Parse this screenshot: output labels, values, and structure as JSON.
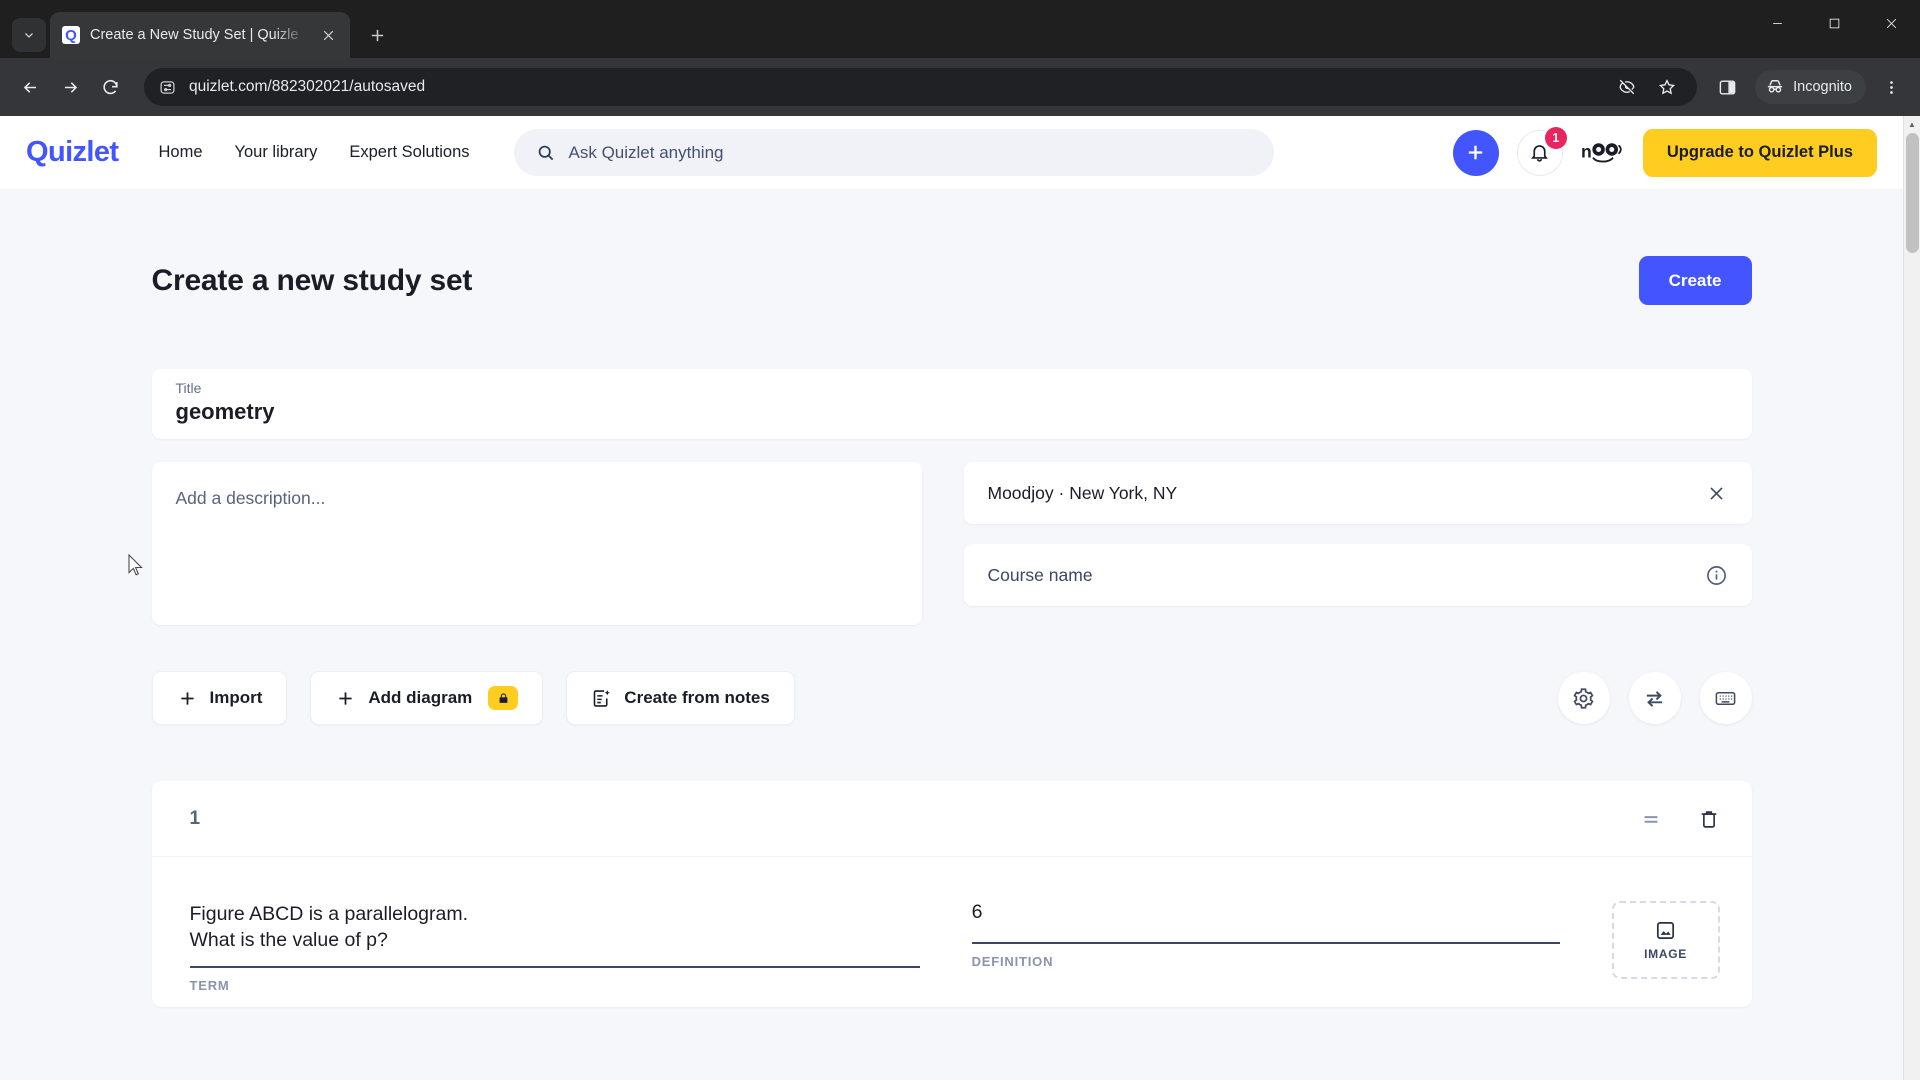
{
  "browser": {
    "tab": {
      "title": "Create a New Study Set | Quizle",
      "favicon_letter": "Q"
    },
    "tab_list_icon": "chevron-down-icon",
    "new_tab_icon": "plus-icon",
    "window_controls": [
      "minimize",
      "maximize",
      "close"
    ],
    "nav": {
      "back": "back-arrow-icon",
      "forward": "forward-arrow-icon",
      "reload": "reload-icon"
    },
    "omnibox": {
      "site_info_icon": "page-settings-icon",
      "url": "quizlet.com/882302021/autosaved",
      "actions": [
        "eye-off-icon",
        "star-icon",
        "side-panel-icon"
      ]
    },
    "incognito": {
      "label": "Incognito",
      "icon": "incognito-icon"
    },
    "menu_icon": "kebab-menu-icon"
  },
  "header": {
    "logo": "Quizlet",
    "nav": [
      {
        "label": "Home"
      },
      {
        "label": "Your library"
      },
      {
        "label": "Expert Solutions"
      }
    ],
    "search": {
      "placeholder": "Ask Quizlet anything",
      "icon": "search-icon"
    },
    "create_icon": "plus-icon",
    "notifications": {
      "icon": "bell-icon",
      "count": "1"
    },
    "avatar": "user-avatar",
    "upgrade": {
      "label": "Upgrade to Quizlet Plus"
    }
  },
  "page": {
    "title": "Create a new study set",
    "create_button": "Create"
  },
  "form": {
    "title_field": {
      "label": "Title",
      "value": "geometry"
    },
    "description": {
      "placeholder": "Add a description..."
    },
    "school": {
      "value": "Moodjoy · New York, NY",
      "clear_icon": "close-icon"
    },
    "course": {
      "placeholder": "Course name",
      "info_icon": "info-icon"
    }
  },
  "toolbar": {
    "import": {
      "label": "Import",
      "icon": "plus-icon"
    },
    "add_diagram": {
      "label": "Add diagram",
      "icon": "plus-icon",
      "badge_icon": "lock-icon"
    },
    "create_from_notes": {
      "label": "Create from notes",
      "icon": "notes-sparkle-icon"
    },
    "settings_icon": "gear-icon",
    "swap_icon": "swap-arrows-icon",
    "keyboard_icon": "keyboard-icon"
  },
  "cards": [
    {
      "number": "1",
      "drag_icon": "drag-handle-icon",
      "delete_icon": "trash-icon",
      "term": "Figure ABCD is a parallelogram.\nWhat is the value of p?",
      "term_label": "TERM",
      "definition": "6",
      "definition_label": "DEFINITION",
      "image_button": {
        "label": "IMAGE",
        "icon": "image-icon"
      }
    }
  ],
  "colors": {
    "brand": "#4255ff",
    "accent_yellow": "#ffcd1f",
    "badge_red": "#e8255f",
    "page_bg": "#f6f7fb",
    "text": "#1a1d28"
  }
}
